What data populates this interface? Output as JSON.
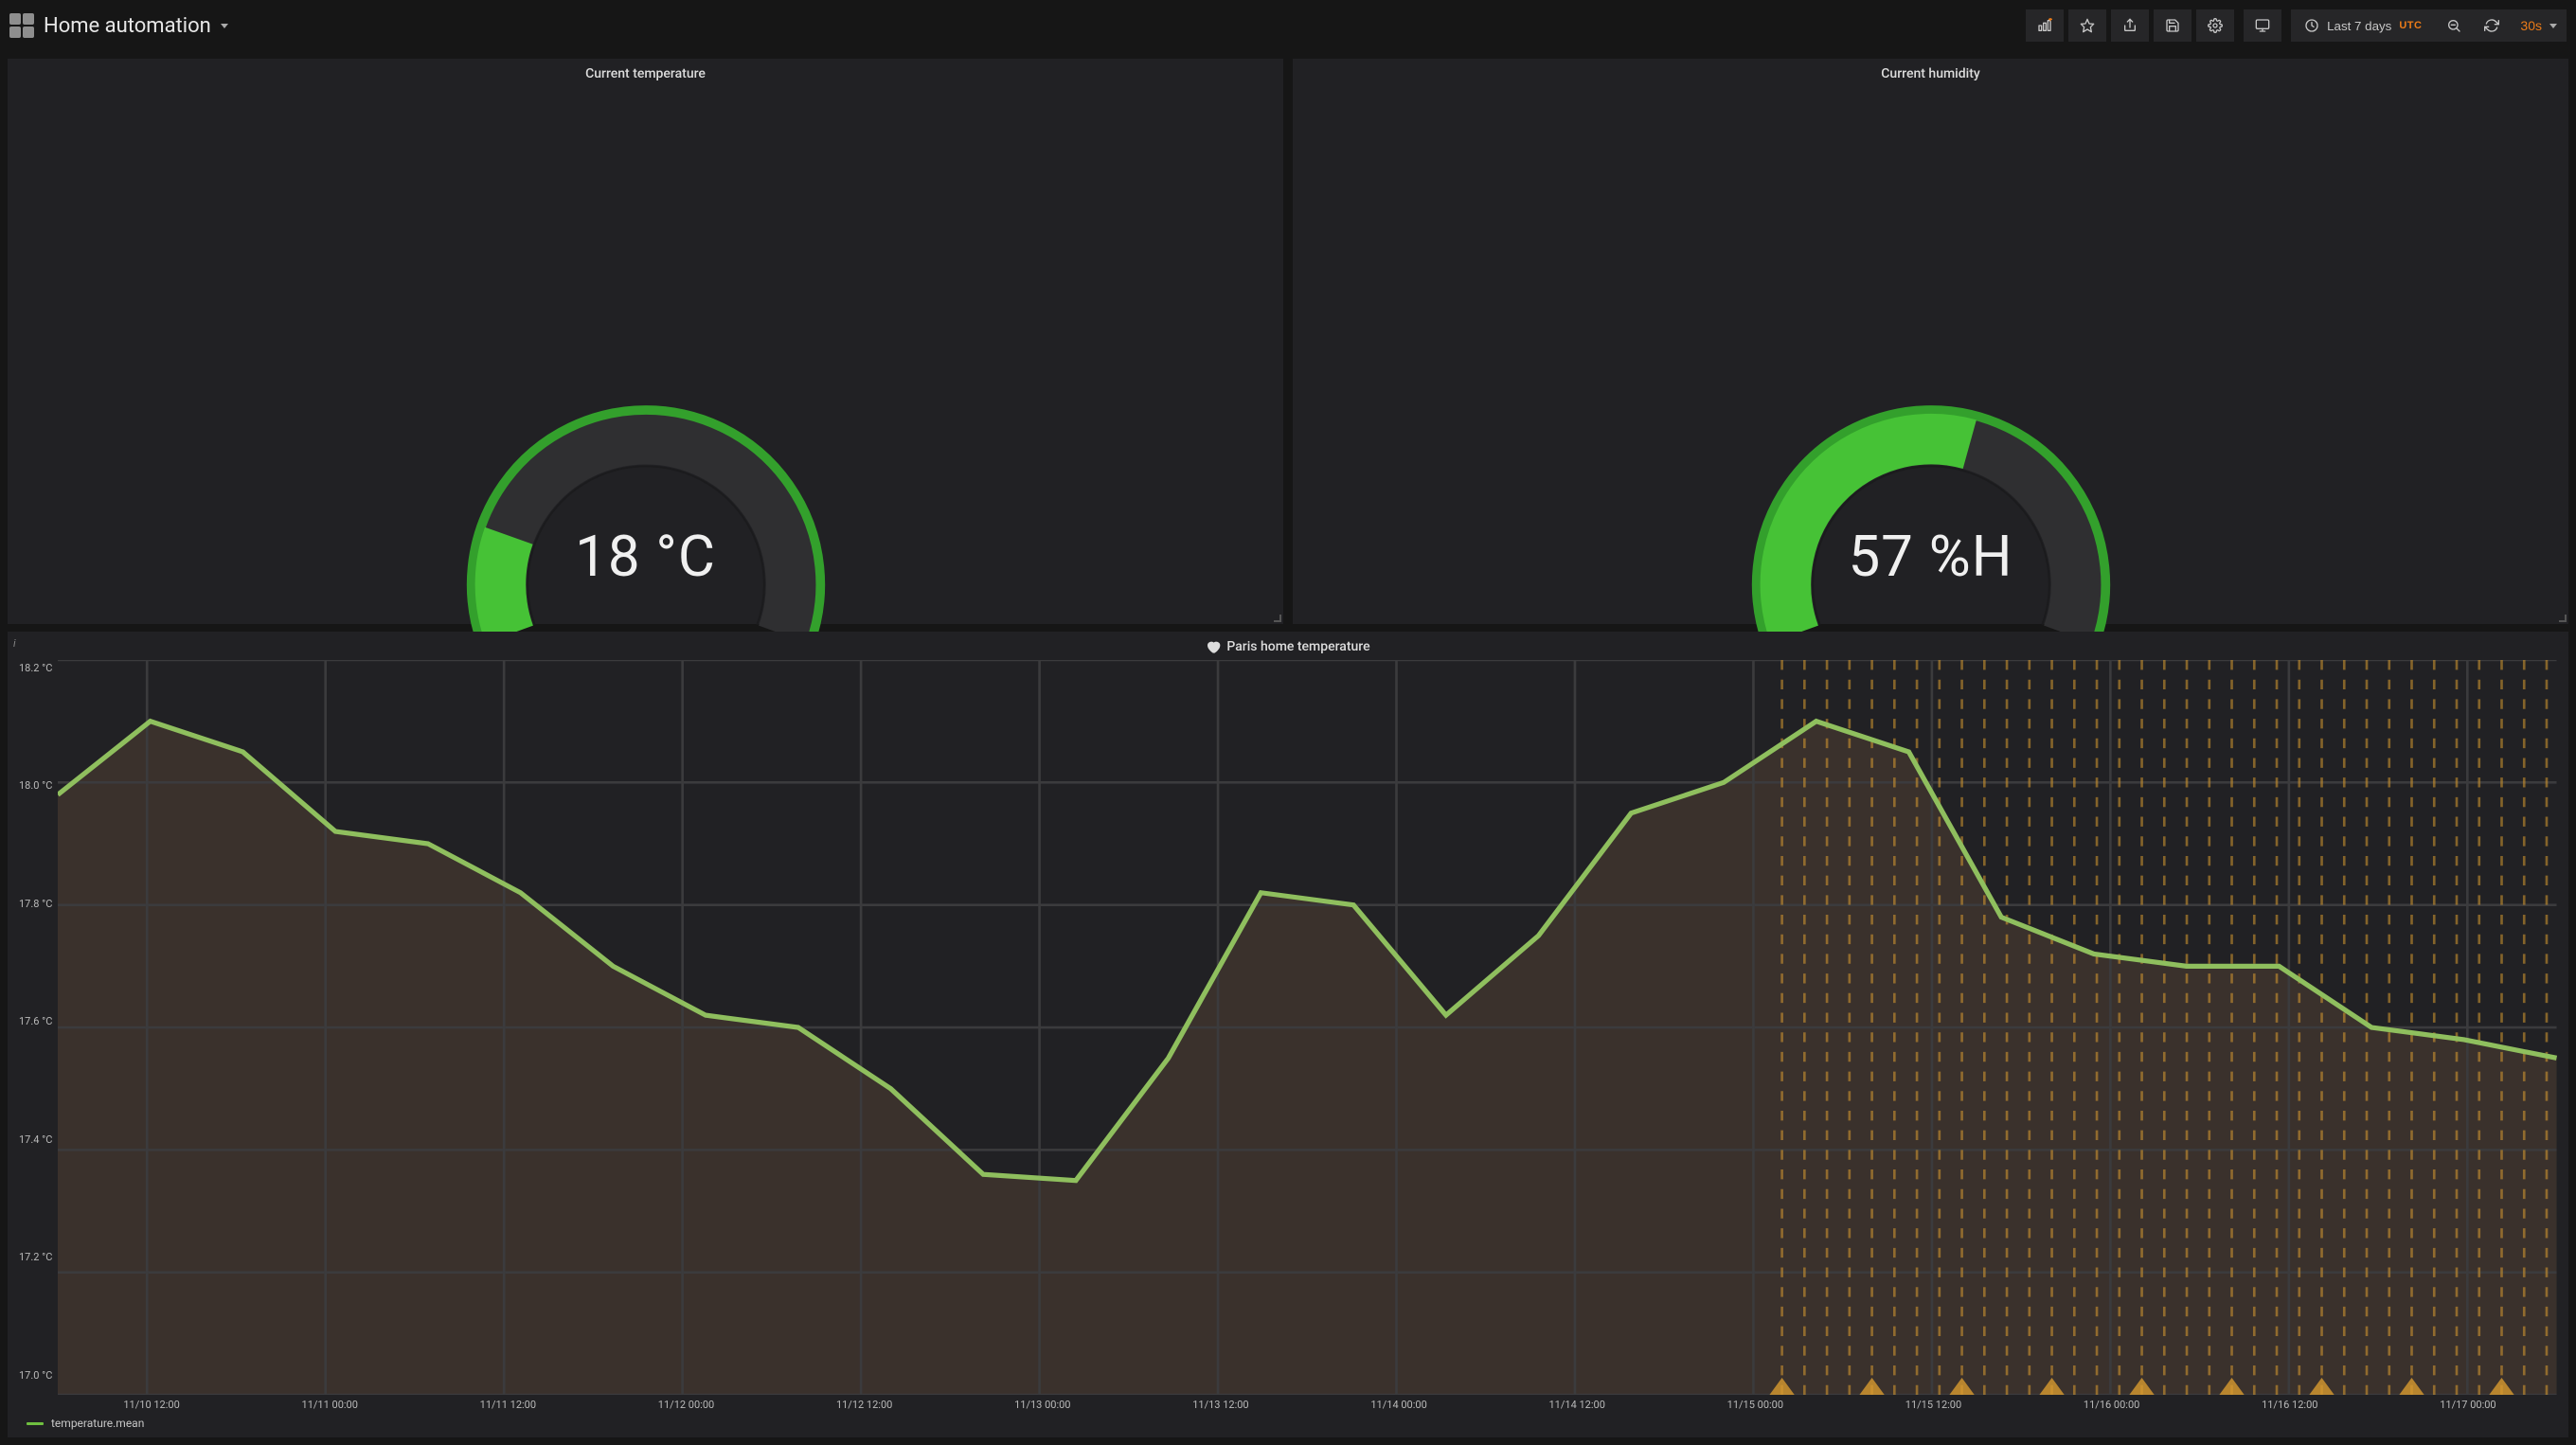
{
  "colors": {
    "accent": "#eb7b18",
    "gauge_fill": "#33a02c",
    "gauge_fill_light": "#46c236",
    "gauge_track": "#2f2f31",
    "chart_line": "#8fbf5e",
    "chart_fill": "#3d332d",
    "grid": "#3b3b3d",
    "annotation": "#d89b30"
  },
  "header": {
    "title": "Home automation",
    "time_range_label": "Last 7 days",
    "tz_badge": "UTC",
    "refresh_interval": "30s"
  },
  "panels": {
    "temp_gauge": {
      "title": "Current temperature",
      "value_text": "18 °C",
      "value": 18,
      "min": 0,
      "max": 100,
      "fill_fraction": 0.18
    },
    "humidity_gauge": {
      "title": "Current humidity",
      "value_text": "57 %H",
      "value": 57,
      "min": 0,
      "max": 100,
      "fill_fraction": 0.57
    },
    "temp_chart": {
      "title": "Paris home temperature",
      "icon": "heart",
      "legend": [
        "temperature.mean"
      ],
      "y_ticks": [
        "18.2 °C",
        "18.0 °C",
        "17.8 °C",
        "17.6 °C",
        "17.4 °C",
        "17.2 °C",
        "17.0 °C"
      ],
      "x_ticks": [
        "11/10 12:00",
        "11/11 00:00",
        "11/11 12:00",
        "11/12 00:00",
        "11/12 12:00",
        "11/13 00:00",
        "11/13 12:00",
        "11/14 00:00",
        "11/14 12:00",
        "11/15 00:00",
        "11/15 12:00",
        "11/16 00:00",
        "11/16 12:00",
        "11/17 00:00"
      ],
      "annotation_region_start_frac": 0.69
    }
  },
  "chart_data": {
    "type": "line",
    "title": "Paris home temperature",
    "ylabel": "°C",
    "ylim": [
      17.0,
      18.2
    ],
    "x": [
      "11/10 12:00",
      "11/10 18:00",
      "11/11 00:00",
      "11/11 06:00",
      "11/11 12:00",
      "11/11 18:00",
      "11/12 00:00",
      "11/12 06:00",
      "11/12 12:00",
      "11/12 18:00",
      "11/13 00:00",
      "11/13 06:00",
      "11/13 12:00",
      "11/13 18:00",
      "11/14 00:00",
      "11/14 06:00",
      "11/14 12:00",
      "11/14 18:00",
      "11/15 00:00",
      "11/15 06:00",
      "11/15 12:00",
      "11/15 18:00",
      "11/16 00:00",
      "11/16 06:00",
      "11/16 12:00",
      "11/16 18:00",
      "11/17 00:00",
      "11/17 06:00"
    ],
    "series": [
      {
        "name": "temperature.mean",
        "values": [
          17.98,
          18.1,
          18.05,
          17.92,
          17.9,
          17.82,
          17.7,
          17.62,
          17.6,
          17.5,
          17.36,
          17.35,
          17.55,
          17.82,
          17.8,
          17.62,
          17.75,
          17.95,
          18.0,
          18.1,
          18.05,
          17.78,
          17.72,
          17.7,
          17.7,
          17.6,
          17.58,
          17.55
        ]
      }
    ],
    "annotation_region": {
      "from": "11/15 00:00",
      "to": "11/17 06:00"
    }
  }
}
